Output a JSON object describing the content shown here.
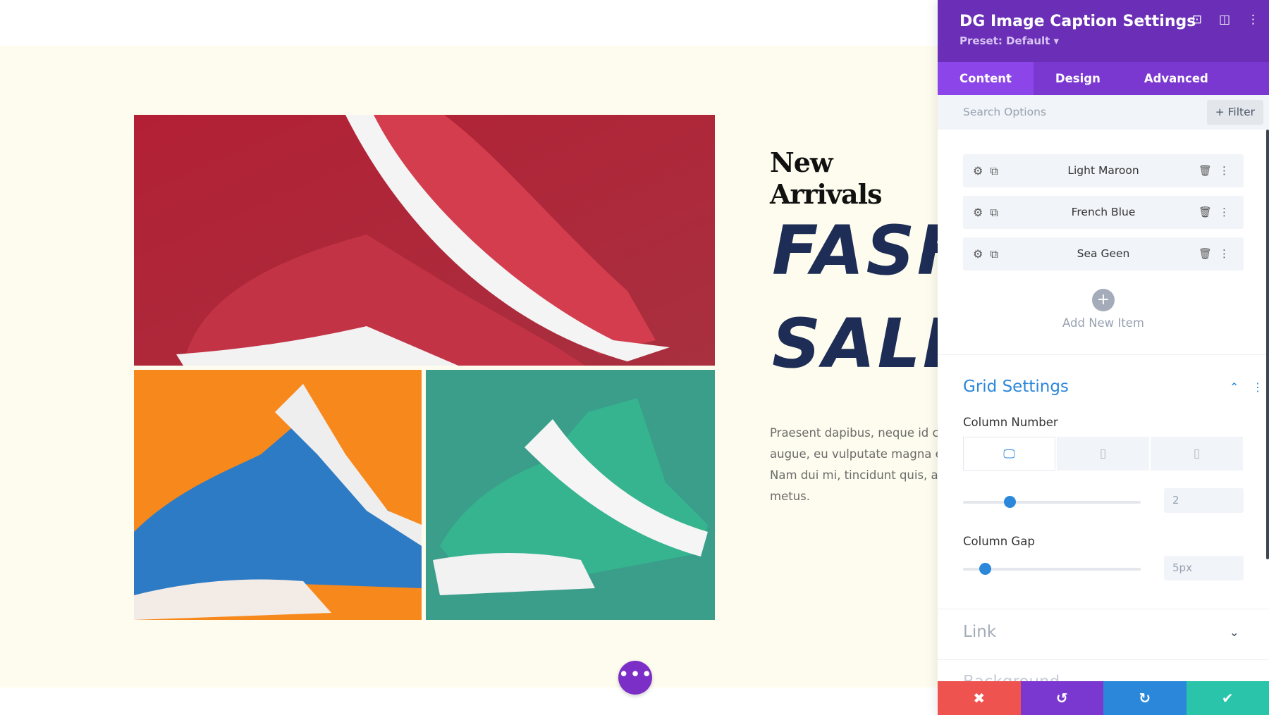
{
  "page": {
    "subtitle": "New Arrivals",
    "headline_line1": "FASH",
    "headline_line2": "SALE",
    "paragraph": [
      "Praesent dapibus, neque id cur",
      "augue, eu vulputate magna er",
      "Nam dui mi, tincidunt quis, acc",
      "metus."
    ],
    "images": [
      {
        "name": "red-sneakers",
        "color": "#b3263a"
      },
      {
        "name": "blue-sneakers",
        "color": "#f7891c"
      },
      {
        "name": "green-sneakers",
        "color": "#3a9e8a"
      }
    ],
    "more_button": "•••"
  },
  "panel": {
    "title": "DG Image Caption Settings",
    "preset": "Preset: Default ▾",
    "header_icons": [
      "focus-icon",
      "split-view-icon",
      "more-vertical-icon"
    ],
    "tabs": [
      {
        "label": "Content",
        "active": true
      },
      {
        "label": "Design"
      },
      {
        "label": "Advanced"
      }
    ],
    "search_placeholder": "Search Options",
    "filter_label": "+ Filter",
    "items": [
      {
        "label": "Light Maroon"
      },
      {
        "label": "French Blue"
      },
      {
        "label": "Sea Geen"
      }
    ],
    "add_new_item": "Add New Item",
    "grid_settings": {
      "title": "Grid Settings",
      "column_number_label": "Column Number",
      "devices": [
        "desktop",
        "tablet",
        "phone"
      ],
      "column_number_value": "2",
      "column_gap_label": "Column Gap",
      "column_gap_value": "5px"
    },
    "link_section": "Link",
    "next_section": "Background",
    "actions": [
      {
        "name": "cancel",
        "color": "#ef5350"
      },
      {
        "name": "undo",
        "color": "#7b38d0"
      },
      {
        "name": "redo",
        "color": "#2b87da"
      },
      {
        "name": "save",
        "color": "#29c4a9"
      }
    ],
    "accent": "#2b87da"
  }
}
